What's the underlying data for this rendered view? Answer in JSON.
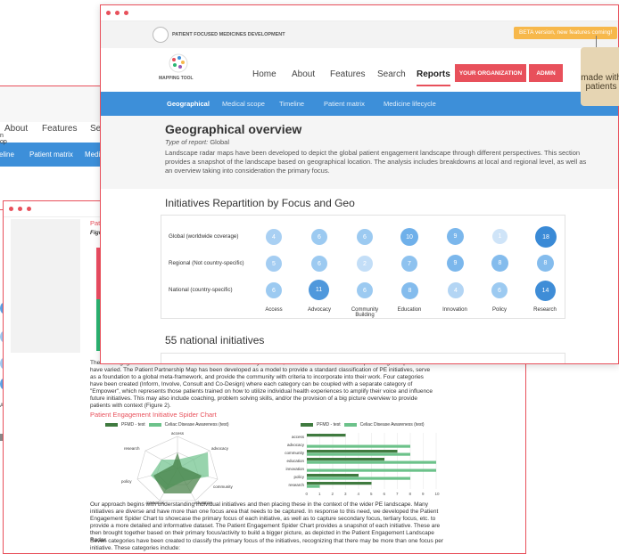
{
  "back_window": {
    "nav": [
      "About",
      "Features",
      "Search"
    ],
    "subnav": [
      "eline",
      "Patient matrix",
      "Medicine"
    ],
    "side_labels": [
      "n",
      "op",
      "Ac"
    ]
  },
  "doc_window": {
    "heading_fragment": "Patien",
    "figure_fragment": "Figure",
    "para1": "There ... engage in initiatives that need to be delineated. Currently however, criteria and definitions around partnering with patients have varied. The Patient Partnership Map has been developed as a model to provide a standard classification of PE initiatives, serve as a foundation to a global meta-framework, and provide the community with criteria to incorporate into their work. Four categories have been created (Inform, Involve, Consult and Co-Design) where each category can be coupled with a separate category of \"Empower\", which represents those patients trained on how to utilize individual health experiences to amplify their voice and influence future initiatives. This may also include coaching, problem solving skills, and/or the provision of a big picture overview to provide patients with context (Figure 2).",
    "spider_title": "Patient Engagement Initiative Spider Chart",
    "legend": [
      "PFMD - test",
      "Celiac Disease Awareness (test)"
    ],
    "radar_axes": [
      "access",
      "advocacy",
      "community",
      "education",
      "innovation",
      "policy",
      "research"
    ],
    "para2": "Our approach begins with understanding individual initiatives and then placing these in the context of the wider PE landscape. Many initiatives are diverse and have more than one focus area that needs to be captured. In response to this need, we developed the Patient Engagement Spider Chart to showcase the primary focus of each initiative, as well as to capture secondary focus, tertiary focus, etc. to provide a more detailed and informative dataset. The Patient Engagement Spider Chart provides a snapshot of each initiative. These are then brought together based on their primary focus/activity to build a bigger picture, as depicted in the Patient Engagement Landscape Radar.",
    "para3": "Seven categories have been created to classify the primary focus of the initiatives, recognizing that there may be more than one focus per initiative. These categories include:"
  },
  "chart_data": [
    {
      "type": "bar",
      "categories": [
        "access",
        "advocacy",
        "community",
        "education",
        "innovation",
        "policy",
        "research"
      ],
      "series": [
        {
          "name": "PFMD - test",
          "values": [
            3,
            0,
            7,
            6,
            0,
            4,
            5
          ]
        },
        {
          "name": "Celiac Disease Awareness (test)",
          "values": [
            0,
            8,
            8,
            10,
            10,
            8,
            1
          ]
        }
      ],
      "xlim": [
        0,
        10
      ],
      "xticks": [
        "0",
        "1",
        "2",
        "3",
        "4",
        "5",
        "6",
        "7",
        "8",
        "9",
        "10"
      ]
    }
  ],
  "front": {
    "brand": "PATIENT FOCUSED MEDICINES DEVELOPMENT",
    "beta": "BETA version, new features coming!",
    "logo_label": "MAPPING TOOL",
    "nav": [
      "Home",
      "About",
      "Features",
      "Search",
      "Reports"
    ],
    "btn_org": "YOUR ORGANIZATION",
    "btn_admin": "ADMIN",
    "subnav": [
      "Geographical",
      "Medical scope",
      "Timeline",
      "Patient matrix",
      "Medicine lifecycle"
    ],
    "title": "Geographical overview",
    "type_label": "Type of report:",
    "type_value": "Global",
    "description": "Landscape radar maps have been developed to depict the global patient engagement landscape through different perspectives. This section provides a snapshot of the landscape based on geographical location. The analysis includes breakdowns at local and regional level, as well as an overview taking into consideration the primary focus.",
    "section_title": "Initiatives Repartition by Focus and Geo",
    "rows": [
      {
        "label": "Global (worldwide coverage)",
        "values": [
          "4",
          "6",
          "6",
          "10",
          "9",
          "1",
          "18"
        ]
      },
      {
        "label": "Regional (Not country-specific)",
        "values": [
          "5",
          "6",
          "2",
          "7",
          "9",
          "8",
          "8"
        ]
      },
      {
        "label": "National (country-specific)",
        "values": [
          "6",
          "11",
          "6",
          "8",
          "4",
          "6",
          "14"
        ]
      }
    ],
    "columns": [
      "Access",
      "Advocacy",
      "Community Building",
      "Education",
      "Innovation",
      "Policy",
      "Research"
    ],
    "national_title": "55 national initiatives",
    "tag": "made with patients"
  },
  "colors": {
    "accent": "#e8505b",
    "blue": "#3d8fd9"
  }
}
